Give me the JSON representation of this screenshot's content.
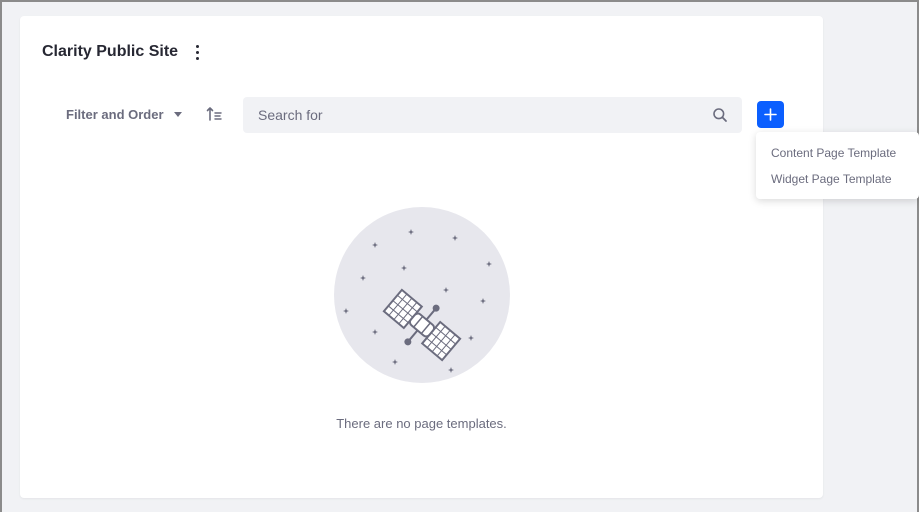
{
  "header": {
    "title": "Clarity Public Site",
    "menu_icon": "kebab-vertical-icon"
  },
  "toolbar": {
    "filter_label": "Filter and Order",
    "filter_icon": "caret-down-icon",
    "sort_icon": "sort-order-icon",
    "search_placeholder": "Search for",
    "search_value": "",
    "search_icon": "search-icon",
    "add_icon": "plus-icon"
  },
  "add_menu": {
    "items": [
      {
        "label": "Content Page Template"
      },
      {
        "label": "Widget Page Template"
      }
    ]
  },
  "empty_state": {
    "illustration": "satellite-illustration",
    "message": "There are no page templates."
  },
  "colors": {
    "primary": "#0b5fff",
    "text_dark": "#272833",
    "text_muted": "#6b6c7e",
    "surface": "#f1f2f5"
  }
}
